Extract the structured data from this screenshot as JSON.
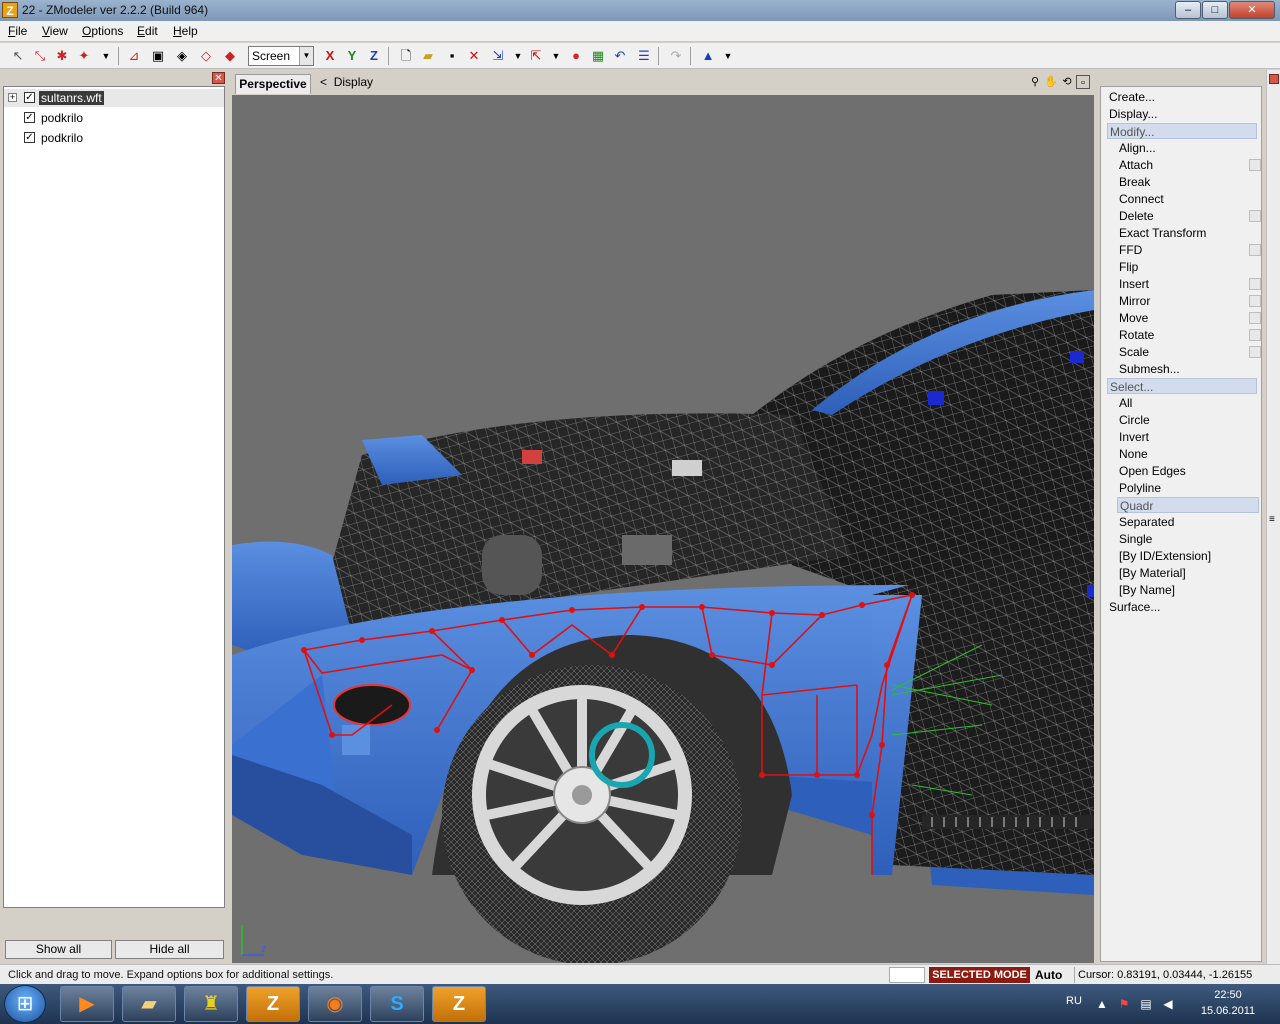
{
  "window": {
    "title": "22 - ZModeler ver 2.2.2 (Build 964)",
    "app_icon": "Z",
    "minimize": "–",
    "maximize": "□",
    "close": "✕"
  },
  "menu": {
    "file": "File",
    "view": "View",
    "options": "Options",
    "edit": "Edit",
    "help": "Help"
  },
  "toolbar": {
    "screen_value": "Screen",
    "axis_x": "X",
    "axis_y": "Y",
    "axis_z": "Z"
  },
  "tree": {
    "items": [
      {
        "label": "sultanrs.wft",
        "checked": "✓",
        "expander": "+"
      },
      {
        "label": "podkrilo",
        "checked": "✓"
      },
      {
        "label": "podkrilo",
        "checked": "✓"
      }
    ],
    "show_all": "Show all",
    "hide_all": "Hide all"
  },
  "viewport": {
    "tab": "Perspective",
    "crumb_arrow": "<",
    "display": "Display",
    "axis_z": "z"
  },
  "commands": {
    "create": "Create...",
    "display": "Display...",
    "modify": "Modify...",
    "modify_items": [
      "Align...",
      "Attach",
      "Break",
      "Connect",
      "Delete",
      "Exact Transform",
      "FFD",
      "Flip",
      "Insert",
      "Mirror",
      "Move",
      "Rotate",
      "Scale",
      "Submesh..."
    ],
    "select": "Select...",
    "select_items": [
      "All",
      "Circle",
      "Invert",
      "None",
      "Open Edges",
      "Polyline",
      "Quadr",
      "Separated",
      "Single",
      "[By ID/Extension]",
      "[By Material]",
      "[By Name]"
    ],
    "surface": "Surface..."
  },
  "status": {
    "text": "Click and drag to move. Expand options box for additional settings.",
    "mode": "SELECTED MODE",
    "auto": "Auto",
    "cursor": "Cursor: 0.83191, 0.03444, -1.26155"
  },
  "taskbar": {
    "lang": "RU",
    "time": "22:50",
    "date": "15.06.2011"
  }
}
